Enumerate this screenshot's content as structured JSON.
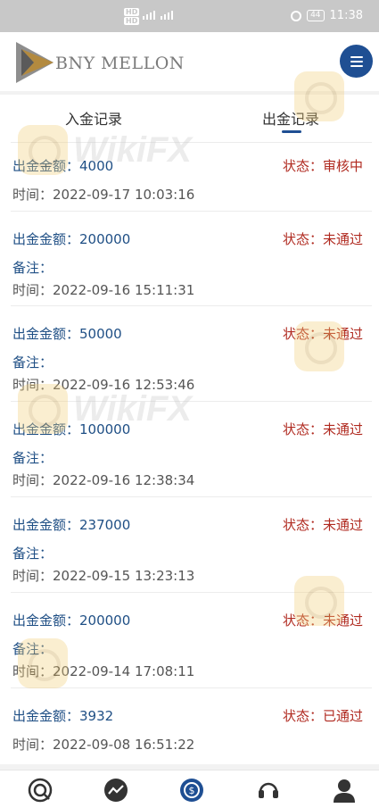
{
  "status_bar": {
    "net_top": "HD",
    "net_bottom": "HD",
    "net_type": "4G",
    "net_type2": "5G",
    "battery": "44",
    "time": "11:38"
  },
  "header": {
    "brand": "BNY MELLON",
    "menu_icon": "menu-icon",
    "brand_color": "#1f4f93"
  },
  "tabs": [
    {
      "label": "入金记录",
      "active": false
    },
    {
      "label": "出金记录",
      "active": true
    }
  ],
  "records": [
    {
      "amount_label": "出金金额：4000",
      "status_label": "状态：审核中",
      "note_label": "",
      "time_label": "时间：2022-09-17 10:03:16"
    },
    {
      "amount_label": "出金金额：200000",
      "status_label": "状态：未通过",
      "note_label": "备注：",
      "time_label": "时间：2022-09-16 15:11:31"
    },
    {
      "amount_label": "出金金额：50000",
      "status_label": "状态：未通过",
      "note_label": "备注：",
      "time_label": "时间：2022-09-16 12:53:46"
    },
    {
      "amount_label": "出金金额：100000",
      "status_label": "状态：未通过",
      "note_label": "备注：",
      "time_label": "时间：2022-09-16 12:38:34"
    },
    {
      "amount_label": "出金金额：237000",
      "status_label": "状态：未通过",
      "note_label": "备注：",
      "time_label": "时间：2022-09-15 13:23:13"
    },
    {
      "amount_label": "出金金额：200000",
      "status_label": "状态：未通过",
      "note_label": "备注：",
      "time_label": "时间：2022-09-14 17:08:11"
    },
    {
      "amount_label": "出金金额：3932",
      "status_label": "状态：已通过",
      "note_label": "",
      "time_label": "时间：2022-09-08 16:51:22"
    }
  ],
  "watermark": "WikiFX",
  "bottom_nav": [
    {
      "icon": "home-icon"
    },
    {
      "icon": "trend-icon"
    },
    {
      "icon": "exchange-icon",
      "active": true
    },
    {
      "icon": "headset-icon"
    },
    {
      "icon": "user-icon"
    }
  ],
  "colors": {
    "accent": "#1f4f93",
    "amount_text": "#1f4f85",
    "status_text": "#b02a20"
  }
}
